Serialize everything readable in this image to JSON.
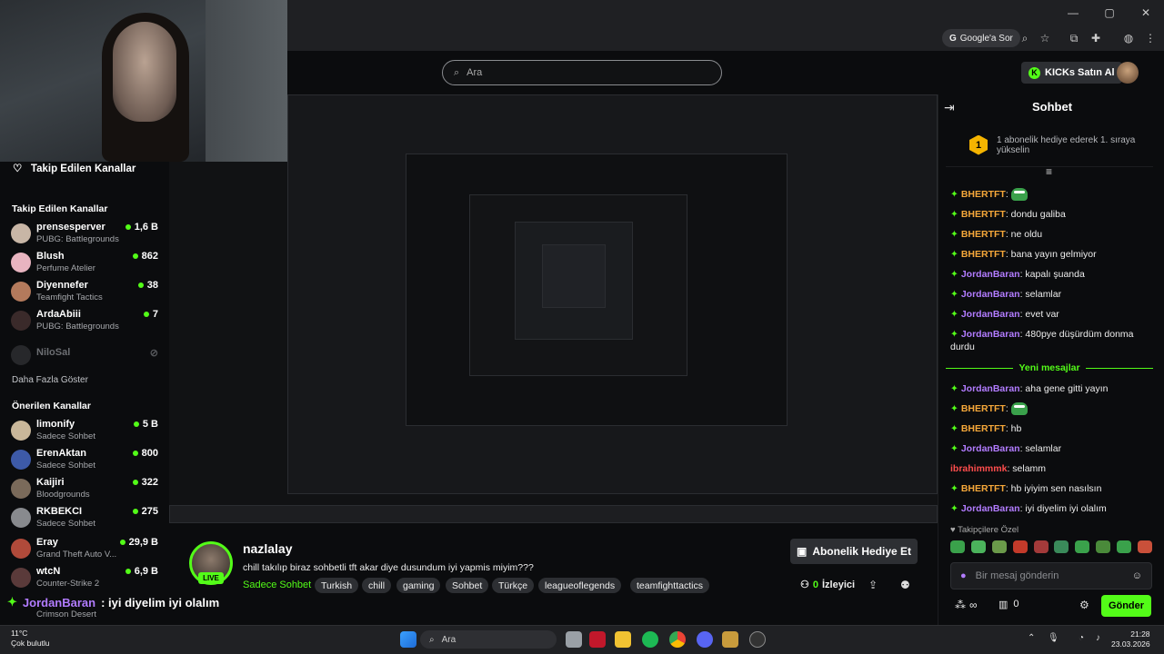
{
  "browser": {
    "google_sor": "Google'a Sor",
    "win_controls": [
      "—",
      "▢",
      "✕"
    ]
  },
  "header": {
    "search_placeholder": "Ara",
    "kicks_button": "KICKs Satın Al"
  },
  "sidebar": {
    "following_title": "Takip Edilen Kanallar",
    "following_section": "Takip Edilen Kanallar",
    "following": [
      {
        "name": "prensesperver",
        "game": "PUBG: Battlegrounds",
        "viewers": "1,6 B"
      },
      {
        "name": "Blush",
        "game": "Perfume Atelier",
        "viewers": "862"
      },
      {
        "name": "Diyennefer",
        "game": "Teamfight Tactics",
        "viewers": "38"
      },
      {
        "name": "ArdaAbiii",
        "game": "PUBG: Battlegrounds",
        "viewers": "7"
      },
      {
        "name": "NiloSal",
        "game": "",
        "viewers": ""
      }
    ],
    "show_more": "Daha Fazla Göster",
    "recommended_section": "Önerilen Kanallar",
    "recommended": [
      {
        "name": "limonify",
        "game": "Sadece Sohbet",
        "viewers": "5 B"
      },
      {
        "name": "ErenAktan",
        "game": "Sadece Sohbet",
        "viewers": "800"
      },
      {
        "name": "Kaijiri",
        "game": "Bloodgrounds",
        "viewers": "322"
      },
      {
        "name": "RKBEKCI",
        "game": "Sadece Sohbet",
        "viewers": "275"
      },
      {
        "name": "Eray",
        "game": "Grand Theft Auto V...",
        "viewers": "29,9 B"
      },
      {
        "name": "wtcN",
        "game": "Counter-Strike 2",
        "viewers": "6,9 B"
      },
      {
        "name": "",
        "game": "Crimson Desert",
        "viewers": ""
      }
    ]
  },
  "stream": {
    "streamer": "nazlalay",
    "live": "LIVE",
    "title": "chill takılıp biraz sohbetli tft akar diye dusundum iyi yapmis miyim???",
    "category": "Sadece Sohbet",
    "tags": [
      "Turkish",
      "chill",
      "gaming",
      "Sohbet",
      "Türkçe",
      "leagueoflegends",
      "teamfighttactics"
    ],
    "gift_button": "Abonelik Hediye Et",
    "viewers_count": "0",
    "viewers_label": "İzleyici",
    "overlay_user": "JordanBaran",
    "overlay_text": ": iyi diyelim iyi olalım"
  },
  "chat": {
    "title": "Sohbet",
    "pinned": "1 abonelik hediye ederek 1. sıraya yükselin",
    "rank": "1",
    "messages": [
      {
        "user": "BHERTFT",
        "text": ":"
      },
      {
        "user": "BHERTFT",
        "text": ": dondu galiba"
      },
      {
        "user": "BHERTFT",
        "text": ": ne oldu"
      },
      {
        "user": "BHERTFT",
        "text": ": bana yayın gelmiyor"
      },
      {
        "user": "JordanBaran",
        "text": ": kapalı şuanda"
      },
      {
        "user": "JordanBaran",
        "text": ": selamlar"
      },
      {
        "user": "JordanBaran",
        "text": ": evet var"
      },
      {
        "user": "JordanBaran",
        "text": ": 480pye düşürdüm donma durdu"
      }
    ],
    "new_messages": "Yeni mesajlar",
    "messages2": [
      {
        "user": "JordanBaran",
        "text": ": aha gene gitti yayın"
      },
      {
        "user": "BHERTFT",
        "text": ":"
      },
      {
        "user": "BHERTFT",
        "text": ": hb"
      },
      {
        "user": "JordanBaran",
        "text": ": selamlar"
      },
      {
        "user": "ibrahimmmk",
        "text": ": selamm"
      },
      {
        "user": "BHERTFT",
        "text": ": hb iyiyim sen nasılsın"
      },
      {
        "user": "JordanBaran",
        "text": ": iyi diyelim iyi olalım"
      }
    ],
    "subs_only": "Takipçilere Özel",
    "input_placeholder": "Bir mesaj gönderin",
    "infinity": "∞",
    "count": "0",
    "send": "Gönder"
  },
  "taskbar": {
    "temp": "11°C",
    "weather": "Çok bulutlu",
    "search": "Ara",
    "time": "21:28",
    "date": "23.03.2026"
  },
  "colors": {
    "accent": "#53fc18",
    "bg": "#0b0c0e",
    "user_orange": "#f6a83a",
    "user_purple": "#b27cff"
  }
}
